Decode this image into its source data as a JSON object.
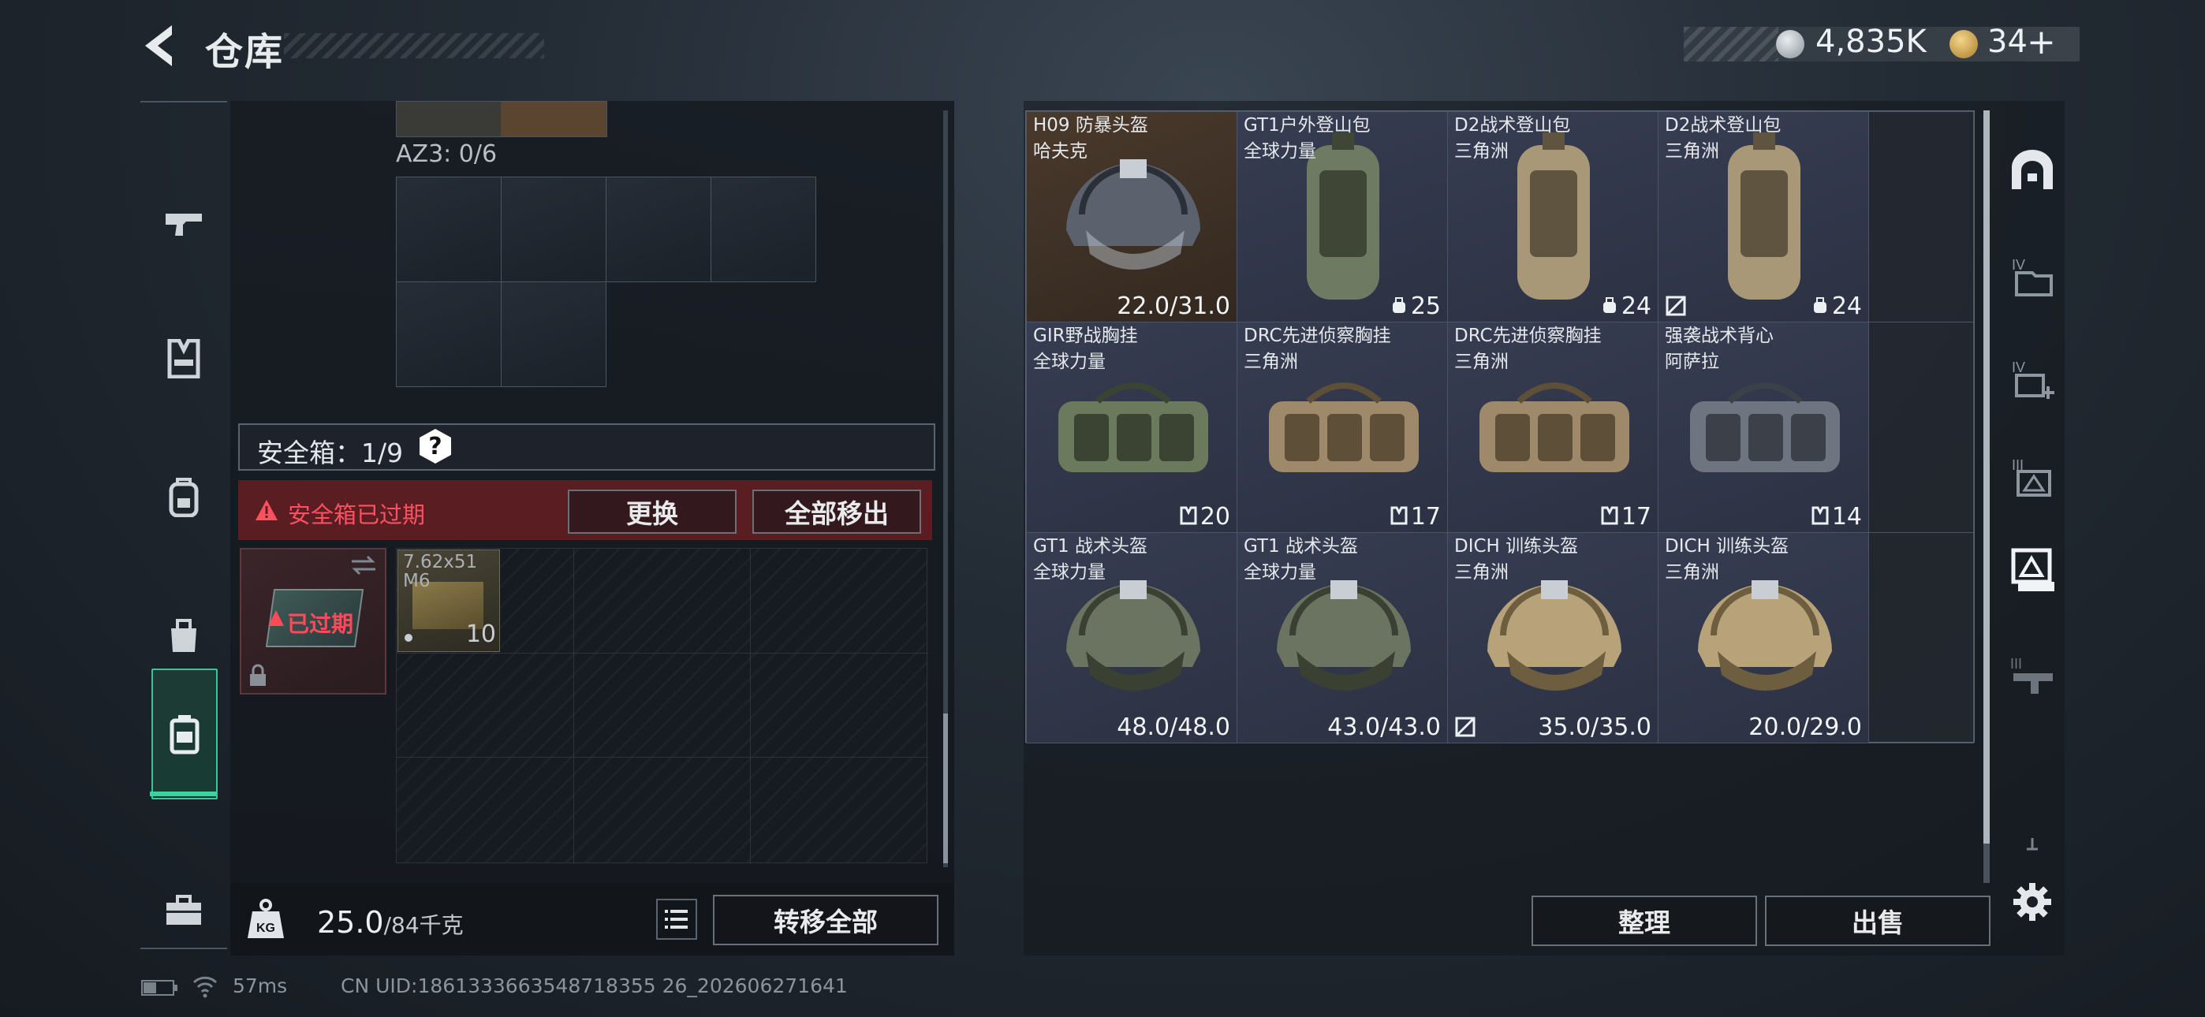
{
  "header": {
    "title": "仓库",
    "currency1": "4,835K",
    "currency2": "34",
    "currency2_plus": "+"
  },
  "left_nav": [
    {
      "name": "weapon",
      "icon": "pistol-icon"
    },
    {
      "name": "chest-rig",
      "icon": "vest-icon"
    },
    {
      "name": "backpack",
      "icon": "backpack-icon"
    },
    {
      "name": "bag",
      "icon": "bag-icon"
    },
    {
      "name": "safe-case",
      "icon": "case-icon",
      "active": true
    },
    {
      "name": "toolbox",
      "icon": "toolbox-icon"
    }
  ],
  "storage": {
    "az3_label": "AZ3: 0/6",
    "safe_label": "安全箱：1/9",
    "help": "?",
    "expired_warning": "安全箱已过期",
    "replace_button": "更换",
    "move_all_button": "全部移出",
    "case_expired": "已过期",
    "ammo_name": "7.62x51",
    "ammo_sub": "M6",
    "ammo_count": "10"
  },
  "weight": {
    "current": "25.0",
    "max": "/84千克",
    "transfer_all": "转移全部"
  },
  "items": [
    {
      "name": "H09 防暴头盔",
      "origin": "哈夫克",
      "value": "22.0/31.0",
      "kind": "helmet-riot",
      "badge": ""
    },
    {
      "name": "GT1户外登山包",
      "origin": "全球力量",
      "value": "25",
      "kind": "pack-green",
      "badge": "capacity"
    },
    {
      "name": "D2战术登山包",
      "origin": "三角洲",
      "value": "24",
      "kind": "pack-tan",
      "badge": "capacity"
    },
    {
      "name": "D2战术登山包",
      "origin": "三角洲",
      "value": "24",
      "kind": "pack-tan",
      "badge": "capacity",
      "locked": true
    },
    {
      "name": "GIR野战胸挂",
      "origin": "全球力量",
      "value": "20",
      "kind": "rig-green",
      "badge": "vest"
    },
    {
      "name": "DRC先进侦察胸挂",
      "origin": "三角洲",
      "value": "17",
      "kind": "rig-tan",
      "badge": "vest"
    },
    {
      "name": "DRC先进侦察胸挂",
      "origin": "三角洲",
      "value": "17",
      "kind": "rig-tan",
      "badge": "vest"
    },
    {
      "name": "强袭战术背心",
      "origin": "阿萨拉",
      "value": "14",
      "kind": "rig-grey",
      "badge": "vest"
    },
    {
      "name": "GT1 战术头盔",
      "origin": "全球力量",
      "value": "48.0/48.0",
      "kind": "helmet-green",
      "badge": ""
    },
    {
      "name": "GT1 战术头盔",
      "origin": "全球力量",
      "value": "43.0/43.0",
      "kind": "helmet-green",
      "badge": ""
    },
    {
      "name": "DICH 训练头盔",
      "origin": "三角洲",
      "value": "35.0/35.0",
      "kind": "helmet-tan",
      "badge": "",
      "locked": true
    },
    {
      "name": "DICH 训练头盔",
      "origin": "三角洲",
      "value": "20.0/29.0",
      "kind": "helmet-tan",
      "badge": ""
    }
  ],
  "actions": {
    "organize": "整理",
    "sell": "出售"
  },
  "right_nav": [
    {
      "name": "home-tab",
      "icon": "arch-icon"
    },
    {
      "name": "tab-iv-folder",
      "icon": "folder-iv-icon"
    },
    {
      "name": "tab-iv-add",
      "icon": "folder-iv-add-icon"
    },
    {
      "name": "tab-iii-image",
      "icon": "folder-iii-icon"
    },
    {
      "name": "tab-active",
      "icon": "folder-active-icon"
    },
    {
      "name": "tab-iii-gun",
      "icon": "folder-iii-gun-icon"
    },
    {
      "name": "add-tab",
      "icon": "plus-icon"
    },
    {
      "name": "settings",
      "icon": "gear-icon"
    }
  ],
  "status": {
    "ping": "57ms",
    "uid": "CN UID:1861333663548718355 26_202606271641"
  },
  "colors": {
    "accent": "#3fd0a0",
    "warning": "#ff5060",
    "expired_bg": "#5a1d22"
  }
}
